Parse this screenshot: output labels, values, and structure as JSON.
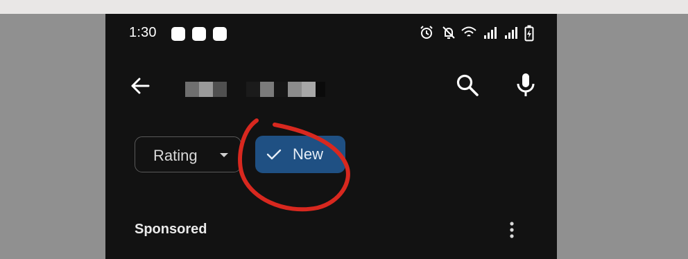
{
  "status_bar": {
    "time": "1:30",
    "notification_icons": [
      "app-icon",
      "app-icon",
      "app-icon"
    ],
    "right_icons": [
      "alarm-icon",
      "mute-icon",
      "wifi-icon",
      "signal-icon",
      "signal-icon",
      "battery-charging-icon"
    ]
  },
  "app_bar": {
    "back_icon": "arrow-back-icon",
    "search_icon": "search-icon",
    "mic_icon": "mic-icon"
  },
  "filters": {
    "rating_label": "Rating",
    "new_label": "New",
    "new_selected": true
  },
  "list": {
    "section_label": "Sponsored"
  },
  "colors": {
    "background": "#121212",
    "chip_selected": "#1f5083",
    "annotation_circle": "#d8281f"
  }
}
